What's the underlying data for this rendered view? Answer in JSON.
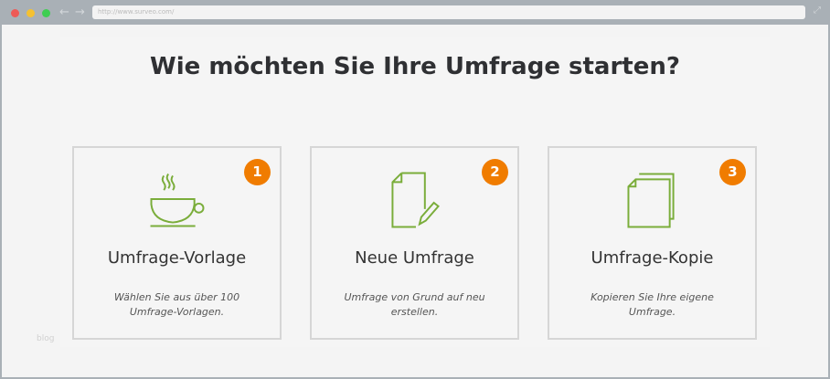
{
  "browser": {
    "url": "http://www.surveo.com/"
  },
  "title": "Wie möchten Sie Ihre Umfrage starten?",
  "cards": [
    {
      "number": "1",
      "title": "Umfrage-Vorlage",
      "description": "Wählen Sie aus über 100 Umfrage-Vorlagen.",
      "icon": "coffee-cup-icon"
    },
    {
      "number": "2",
      "title": "Neue Umfrage",
      "description": "Umfrage von Grund auf neu erstellen.",
      "icon": "document-pencil-icon"
    },
    {
      "number": "3",
      "title": "Umfrage-Kopie",
      "description": "Kopieren Sie Ihre eigene Umfrage.",
      "icon": "copy-documents-icon"
    }
  ],
  "watermark": "blog",
  "colors": {
    "accent": "#f07c00",
    "icon": "#7aad3a"
  }
}
